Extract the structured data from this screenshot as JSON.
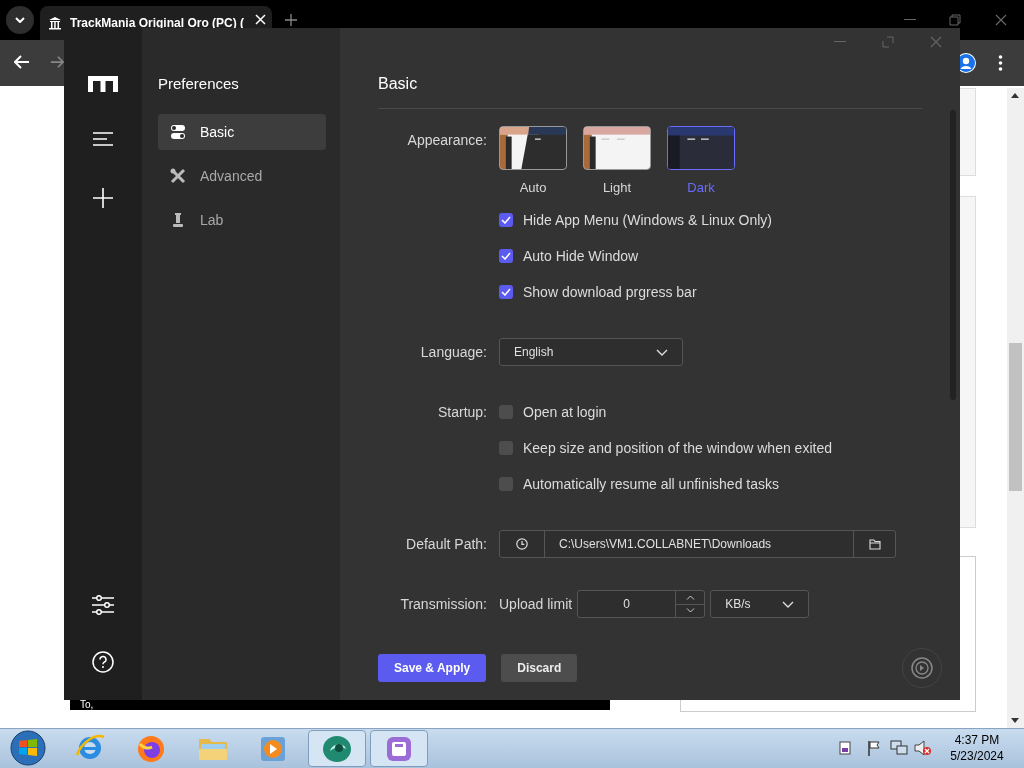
{
  "browser": {
    "tab_title": "TrackMania Original Oro (PC) ("
  },
  "page": {
    "text": "To,"
  },
  "app": {
    "sidebar_title": "Preferences",
    "nav": [
      {
        "label": "Basic",
        "kind": "toggles",
        "selected": true
      },
      {
        "label": "Advanced",
        "kind": "tools",
        "selected": false
      },
      {
        "label": "Lab",
        "kind": "lab",
        "selected": false
      }
    ],
    "section_title": "Basic",
    "appearance": {
      "label": "Appearance:",
      "themes": [
        {
          "label": "Auto",
          "kind": "auto",
          "selected": false
        },
        {
          "label": "Light",
          "kind": "light",
          "selected": false
        },
        {
          "label": "Dark",
          "kind": "dark",
          "selected": true
        }
      ]
    },
    "options": [
      {
        "label": "Hide App Menu (Windows & Linux Only)",
        "checked": true
      },
      {
        "label": "Auto Hide Window",
        "checked": true
      },
      {
        "label": "Show download prgress bar",
        "checked": true
      }
    ],
    "language": {
      "label": "Language:",
      "value": "English"
    },
    "startup": {
      "label": "Startup:",
      "options": [
        {
          "label": "Open at login",
          "checked": false
        },
        {
          "label": "Keep size and position of the window when exited",
          "checked": false
        },
        {
          "label": "Automatically resume all unfinished tasks",
          "checked": false
        }
      ]
    },
    "default_path": {
      "label": "Default Path:",
      "value": "C:\\Users\\VM1.COLLABNET\\Downloads"
    },
    "transmission": {
      "label": "Transmission:",
      "upload_label": "Upload limit",
      "value": "0",
      "unit": "KB/s"
    },
    "buttons": [
      {
        "label": "Save & Apply",
        "kind": "primary"
      },
      {
        "label": "Discard",
        "kind": "secondary"
      }
    ]
  },
  "taskbar": {
    "time": "4:37 PM",
    "date": "5/23/2024"
  }
}
